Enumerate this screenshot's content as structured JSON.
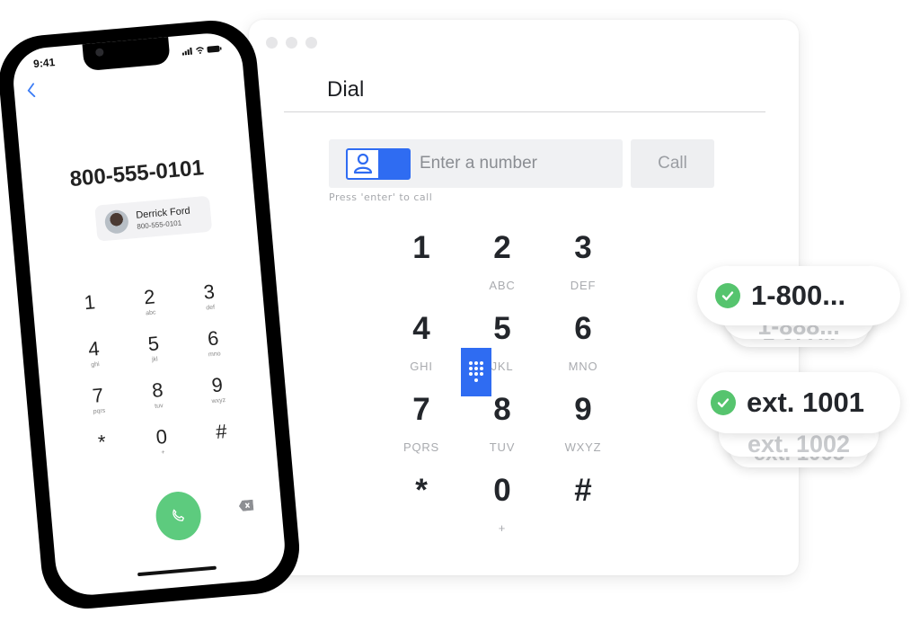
{
  "window": {
    "title": "Dial",
    "input": {
      "placeholder": "Enter a number",
      "value": ""
    },
    "modes": [
      {
        "name": "contacts",
        "icon": "person-icon",
        "active": false
      },
      {
        "name": "keypad",
        "icon": "keypad-icon",
        "active": true
      }
    ],
    "call_label": "Call",
    "hint": "Press 'enter' to call",
    "keys": [
      {
        "digit": "1",
        "letters": ""
      },
      {
        "digit": "2",
        "letters": "ABC"
      },
      {
        "digit": "3",
        "letters": "DEF"
      },
      {
        "digit": "4",
        "letters": "GHI"
      },
      {
        "digit": "5",
        "letters": "JKL"
      },
      {
        "digit": "6",
        "letters": "MNO"
      },
      {
        "digit": "7",
        "letters": "PQRS"
      },
      {
        "digit": "8",
        "letters": "TUV"
      },
      {
        "digit": "9",
        "letters": "WXYZ"
      },
      {
        "digit": "*",
        "letters": ""
      },
      {
        "digit": "0",
        "letters": "+"
      },
      {
        "digit": "#",
        "letters": ""
      }
    ]
  },
  "chips": {
    "numbers": {
      "front": "1-800...",
      "behind": [
        "1-888...",
        "1-877..."
      ]
    },
    "extensions": {
      "front": "ext. 1001",
      "behind": [
        "ext. 1002",
        "ext. 1003"
      ]
    },
    "accent": "#56c46e"
  },
  "phone": {
    "status_time": "9:41",
    "number": "800-555-0101",
    "contact": {
      "name": "Derrick Ford",
      "number": "800-555-0101"
    },
    "keys": [
      {
        "digit": "1",
        "letters": ""
      },
      {
        "digit": "2",
        "letters": "abc"
      },
      {
        "digit": "3",
        "letters": "def"
      },
      {
        "digit": "4",
        "letters": "ghi"
      },
      {
        "digit": "5",
        "letters": "jkl"
      },
      {
        "digit": "6",
        "letters": "mno"
      },
      {
        "digit": "7",
        "letters": "pqrs"
      },
      {
        "digit": "8",
        "letters": "tuv"
      },
      {
        "digit": "9",
        "letters": "wxyz"
      },
      {
        "digit": "*",
        "letters": ""
      },
      {
        "digit": "0",
        "letters": "+"
      },
      {
        "digit": "#",
        "letters": ""
      }
    ],
    "call_color": "#5dcb7e"
  },
  "colors": {
    "primary": "#2f6cf2",
    "success": "#56c46e"
  }
}
